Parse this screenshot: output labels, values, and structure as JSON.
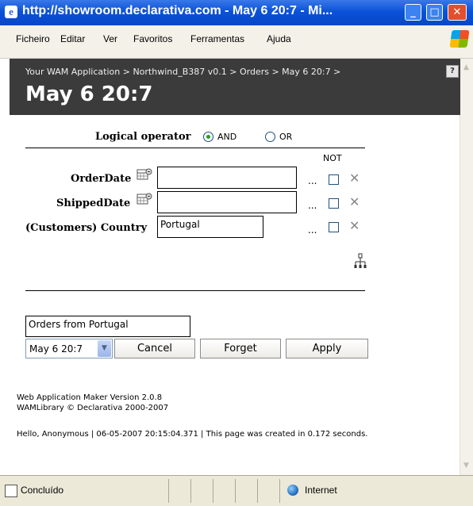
{
  "window": {
    "title": "http://showroom.declarativa.com - May 6 20:7 - Mi...",
    "minimize": "_",
    "maximize": "□",
    "close": "✕"
  },
  "menu": [
    "Ficheiro",
    "Editar",
    "Ver",
    "Favoritos",
    "Ferramentas",
    "Ajuda"
  ],
  "header": {
    "breadcrumb": "Your WAM Application > Northwind_B387 v0.1 > Orders > May 6 20:7 >",
    "title": "May 6 20:7",
    "help": "?"
  },
  "filter": {
    "logical_operator_label": "Logical operator",
    "and_label": "AND",
    "or_label": "OR",
    "selected": "AND",
    "not_label": "NOT",
    "fields": [
      {
        "label": "OrderDate",
        "value": "",
        "has_calendar": true,
        "ellipsis": "...",
        "remove": "✕"
      },
      {
        "label": "ShippedDate",
        "value": "",
        "has_calendar": true,
        "ellipsis": "...",
        "remove": "✕"
      },
      {
        "label": "(Customers) Country",
        "value": "Portugal",
        "has_calendar": false,
        "ellipsis": "...",
        "remove": "✕"
      }
    ]
  },
  "query": {
    "name_value": "Orders from Portugal",
    "selected_query": "May 6 20:7",
    "cancel_label": "Cancel",
    "forget_label": "Forget",
    "apply_label": "Apply"
  },
  "footer": {
    "version": "Web Application Maker Version 2.0.8",
    "copyright": "WAMLibrary © Declarativa 2000-2007",
    "status_line": "Hello, Anonymous  |  06-05-2007 20:15:04.371 | This page was created in 0.172 seconds."
  },
  "statusbar": {
    "text": "Concluído",
    "zone": "Internet"
  },
  "icons": {
    "browser": "ie-icon",
    "calendar": "calendar-icon",
    "hierarchy": "hierarchy-icon",
    "windows_logo": "windows-logo-icon",
    "globe": "globe-icon"
  },
  "colors": {
    "titlebar": "#0a52d8",
    "header_bg": "#3b3b3b",
    "radio_selected": "#21a121"
  }
}
